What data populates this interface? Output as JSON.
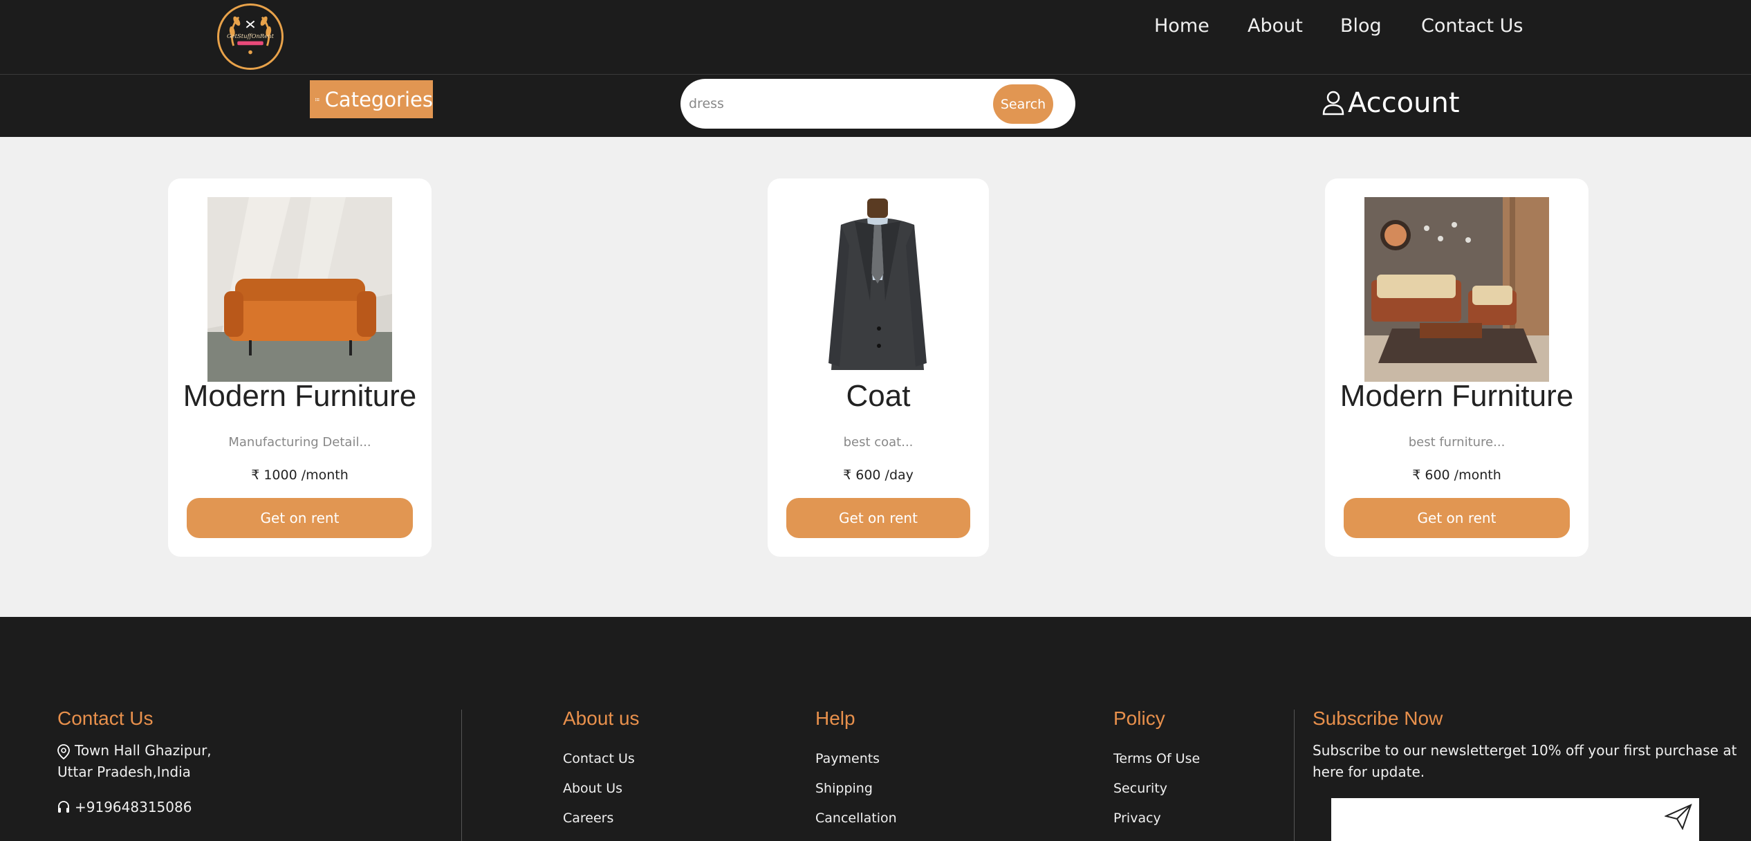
{
  "header": {
    "logo_text": "GetStuffOnRent",
    "nav": [
      "Home",
      "About",
      "Blog",
      "Contact Us"
    ]
  },
  "toolbar": {
    "categories_label": "Categories",
    "search_value": "dress",
    "search_button": "Search",
    "account_label": "Account"
  },
  "products": [
    {
      "title": "Modern Furniture",
      "desc": "Manufacturing Detail...",
      "currency": "₹",
      "price": "1000 /month",
      "button": "Get on rent",
      "image": "sofa"
    },
    {
      "title": "Coat",
      "desc": "best coat...",
      "currency": "₹",
      "price": "600 /day",
      "button": "Get on rent",
      "image": "coat"
    },
    {
      "title": "Modern Furniture",
      "desc": "best furniture...",
      "currency": "₹",
      "price": "600 /month",
      "button": "Get on rent",
      "image": "living-room"
    }
  ],
  "footer": {
    "contact": {
      "heading": "Contact Us",
      "address_line1": "Town Hall Ghazipur,",
      "address_line2": "Uttar Pradesh,India",
      "phone": "+919648315086"
    },
    "about": {
      "heading": "About us",
      "links": [
        "Contact Us",
        "About Us",
        "Careers"
      ]
    },
    "help": {
      "heading": "Help",
      "links": [
        "Payments",
        "Shipping",
        "Cancellation"
      ]
    },
    "policy": {
      "heading": "Policy",
      "links": [
        "Terms Of Use",
        "Security",
        "Privacy"
      ]
    },
    "subscribe": {
      "heading": "Subscribe Now",
      "text_line1": "Subscribe to our newsletterget 10% off your first purchase at",
      "text_line2": "here for update."
    }
  },
  "colors": {
    "accent": "#e19652",
    "footer_heading": "#e8904c",
    "dark": "#1c1c1c",
    "page_bg": "#f0f0f0"
  }
}
